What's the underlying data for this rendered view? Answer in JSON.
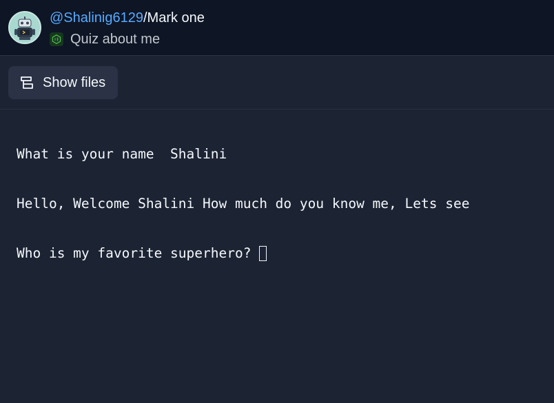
{
  "header": {
    "avatar_icon": "robot-avatar-icon",
    "owner": "@Shalinig6129",
    "separator": "/",
    "repl_name": "Mark one",
    "language_icon": "nodejs-icon",
    "description": "Quiz about me"
  },
  "toolbar": {
    "show_files_icon": "files-stack-icon",
    "show_files_label": "Show files"
  },
  "console": {
    "lines": [
      "What is your name  Shalini",
      "Hello, Welcome Shalini How much do you know me, Lets see",
      "Who is my favorite superhero? "
    ]
  },
  "colors": {
    "background": "#1c2333",
    "header_background": "#0e1525",
    "owner_link": "#57abff",
    "button_background": "#2b3245",
    "text": "#f5f9fc"
  }
}
